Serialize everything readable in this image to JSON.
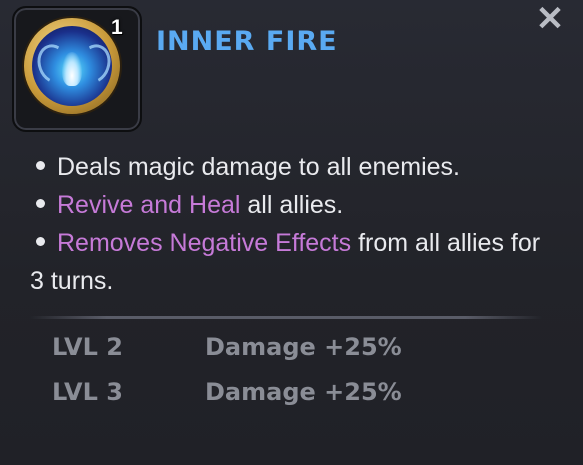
{
  "ability": {
    "title": "INNER FIRE",
    "rank_badge": "1",
    "icon": "inner-fire-ability-icon"
  },
  "close_label": "✕",
  "description": {
    "line1": "Deals magic damage to all enemies.",
    "line2_highlight": "Revive and Heal",
    "line2_rest": " all allies.",
    "line3_highlight": "Removes Negative Effects",
    "line3_rest": " from all allies for",
    "line4": "3 turns."
  },
  "levels": [
    {
      "level": "LVL 2",
      "effect": "Damage +25%"
    },
    {
      "level": "LVL 3",
      "effect": "Damage +25%"
    }
  ],
  "colors": {
    "title": "#5aaaf2",
    "highlight": "#c67ad8",
    "body_text": "#e9eaee",
    "level_text": "#8a8d96",
    "background": "#23242d"
  }
}
